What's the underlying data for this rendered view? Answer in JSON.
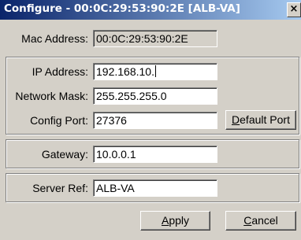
{
  "window": {
    "title": "Configure - 00:0C:29:53:90:2E [ALB-VA]",
    "close_glyph": "×"
  },
  "form": {
    "mac_label": "Mac Address:",
    "mac_value": "00:0C:29:53:90:2E",
    "ip_label": "IP Address:",
    "ip_value": "192.168.10.",
    "mask_label": "Network Mask:",
    "mask_value": "255.255.255.0",
    "port_label": "Config Port:",
    "port_value": "27376",
    "gateway_label": "Gateway:",
    "gateway_value": "10.0.0.1",
    "server_label": "Server Ref:",
    "server_value": "ALB-VA"
  },
  "buttons": {
    "default_port": {
      "mnemonic": "D",
      "rest": "efault Port"
    },
    "apply": {
      "mnemonic": "A",
      "rest": "pply"
    },
    "cancel": {
      "mnemonic": "C",
      "rest": "ancel"
    }
  }
}
